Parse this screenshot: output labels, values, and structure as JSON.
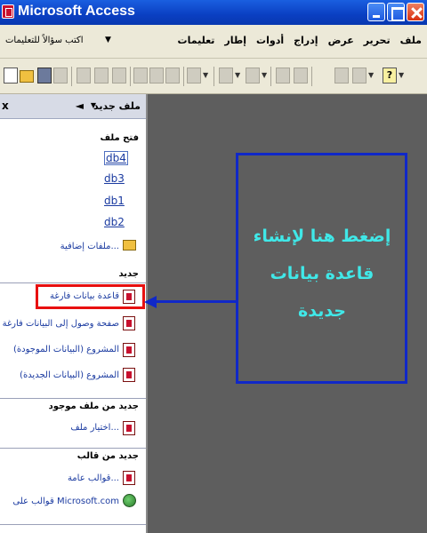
{
  "window": {
    "title": "Microsoft Access"
  },
  "menubar": {
    "items": [
      "ملف",
      "تحرير",
      "عرض",
      "إدراج",
      "أدوات",
      "إطار",
      "تعليمات"
    ],
    "help_placeholder": "اكتب سؤالاً للتعليمات"
  },
  "toolbar": {
    "icons": [
      "new-icon",
      "open-icon",
      "save-icon",
      "search-icon",
      "print-icon",
      "preview-icon",
      "spell-icon",
      "cut-icon",
      "copy-icon",
      "paste-icon",
      "undo-icon",
      "office-links-icon",
      "analyze-icon",
      "properties-icon",
      "relationships-icon",
      "new-object-icon",
      "help-icon"
    ]
  },
  "task_pane": {
    "title": "ملف جديد",
    "sections": {
      "open_file": "فتح ملف",
      "new": "جديد",
      "new_from_existing": "جديد من ملف موجود",
      "new_from_template": "جديد من قالب"
    },
    "recent_files": [
      "db4",
      "db3",
      "db1",
      "db2"
    ],
    "more_files": "ملفات إضافية...",
    "new_items": [
      "قاعدة بيانات فارغة",
      "صفحة وصول إلى البيانات فارغة",
      "المشروع (البيانات الموجودة)",
      "المشروع (البيانات الجديدة)"
    ],
    "choose_file": "اختيار ملف...",
    "general_templates": "قوالب عامة...",
    "templates_online": "قوالب على Microsoft.com"
  },
  "callout": {
    "text": "إضغط هنا لإنشاء قاعدة بيانات جديدة",
    "border_color": "#1028c8",
    "text_color": "#40e8e8"
  },
  "highlight": {
    "color": "#e81010"
  }
}
